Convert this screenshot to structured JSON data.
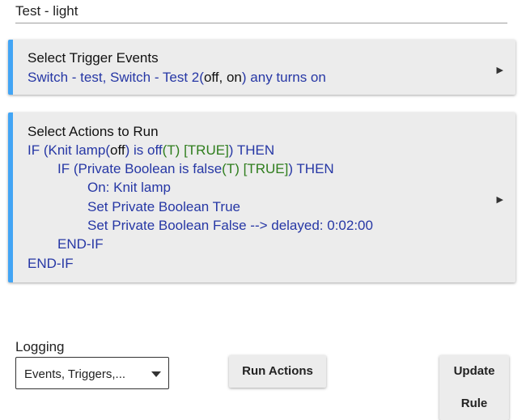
{
  "rule": {
    "name": "Test - light"
  },
  "trigger_card": {
    "title": "Select Trigger Events",
    "devices": "Switch - test, Switch - Test 2",
    "state_values": "off, on",
    "suffix": "any turns on",
    "arrow": "▶"
  },
  "actions_card": {
    "title": "Select Actions to Run",
    "arrow": "▶",
    "line1": {
      "a": "IF (Knit lamp",
      "state": "off",
      "b": ") is off",
      "t": "(T)",
      "truth": "[TRUE]",
      "c": ") THEN"
    },
    "line2": {
      "a": "IF (Private Boolean is false",
      "t": "(T)",
      "truth": "[TRUE]",
      "c": ") THEN"
    },
    "line3": "On: Knit lamp",
    "line4": "Set Private Boolean True",
    "line5": "Set Private Boolean False --> delayed: 0:02:00",
    "line6": "END-IF",
    "line7": "END-IF"
  },
  "logging": {
    "label": "Logging",
    "value": "Events, Triggers,..."
  },
  "buttons": {
    "run_actions": "Run Actions",
    "update_rule_1": "Update",
    "update_rule_2": "Rule"
  }
}
